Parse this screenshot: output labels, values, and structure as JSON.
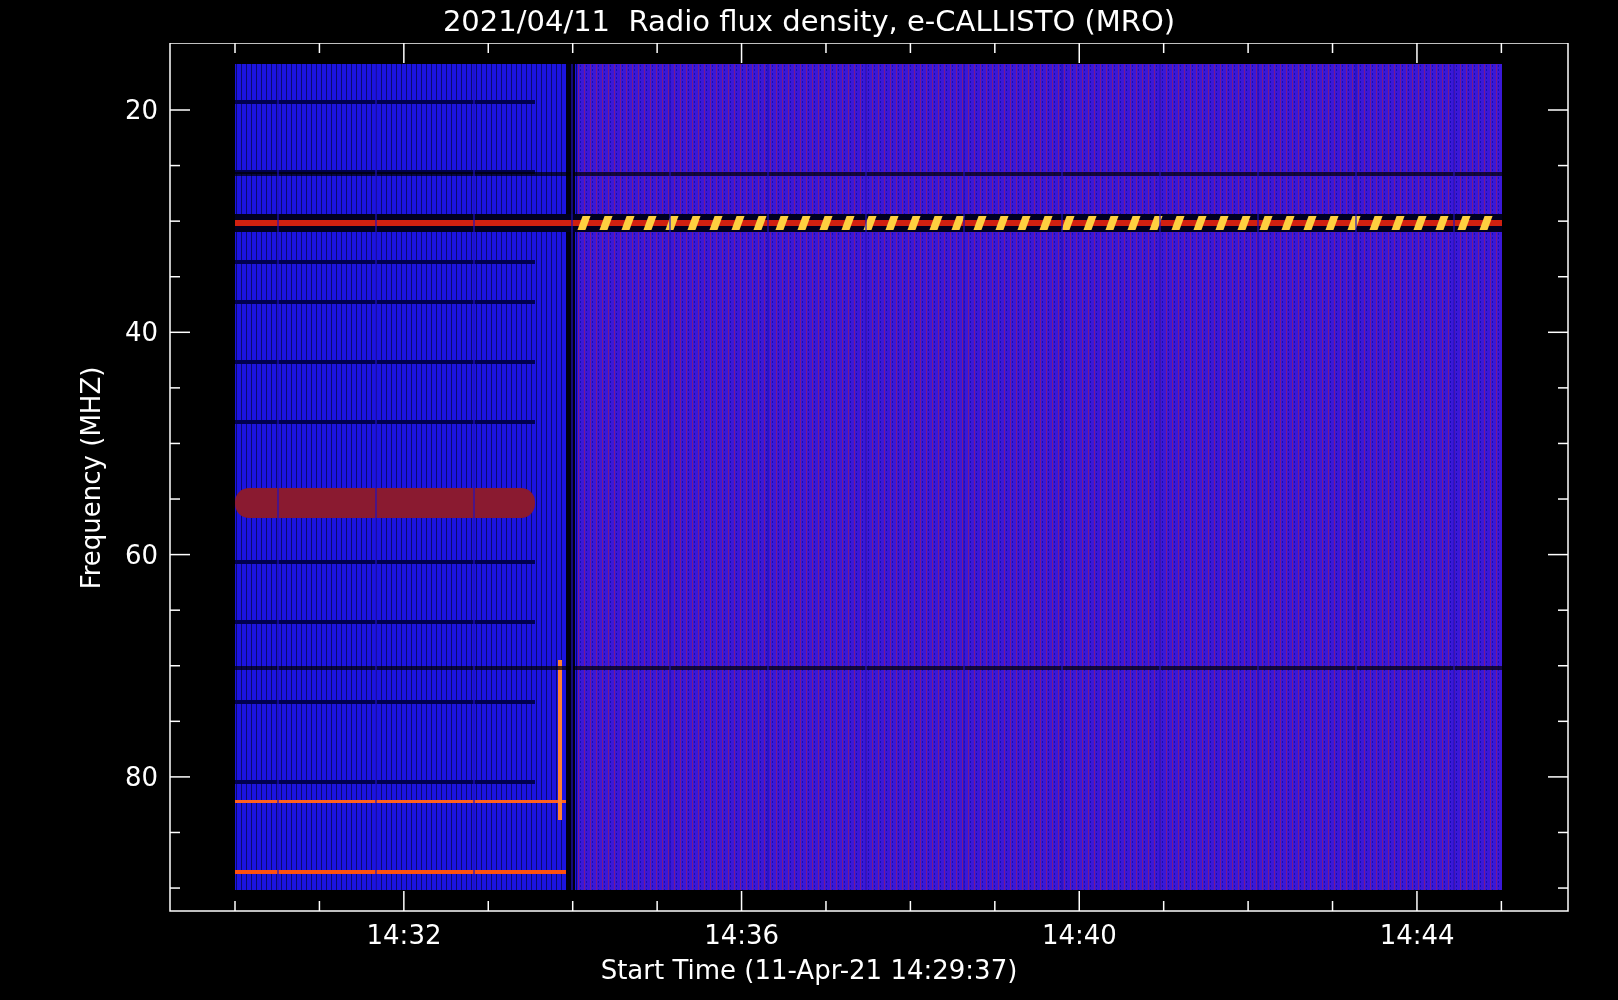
{
  "title": "2021/04/11  Radio flux density, e-CALLISTO (MRO)",
  "y_axis": {
    "label": "Frequency (MHZ)",
    "ticks": [
      "20",
      "40",
      "60",
      "80"
    ]
  },
  "x_axis": {
    "label": "Start Time (11-Apr-21 14:29:37)",
    "ticks": [
      "14:32",
      "14:36",
      "14:40",
      "14:44"
    ]
  }
}
